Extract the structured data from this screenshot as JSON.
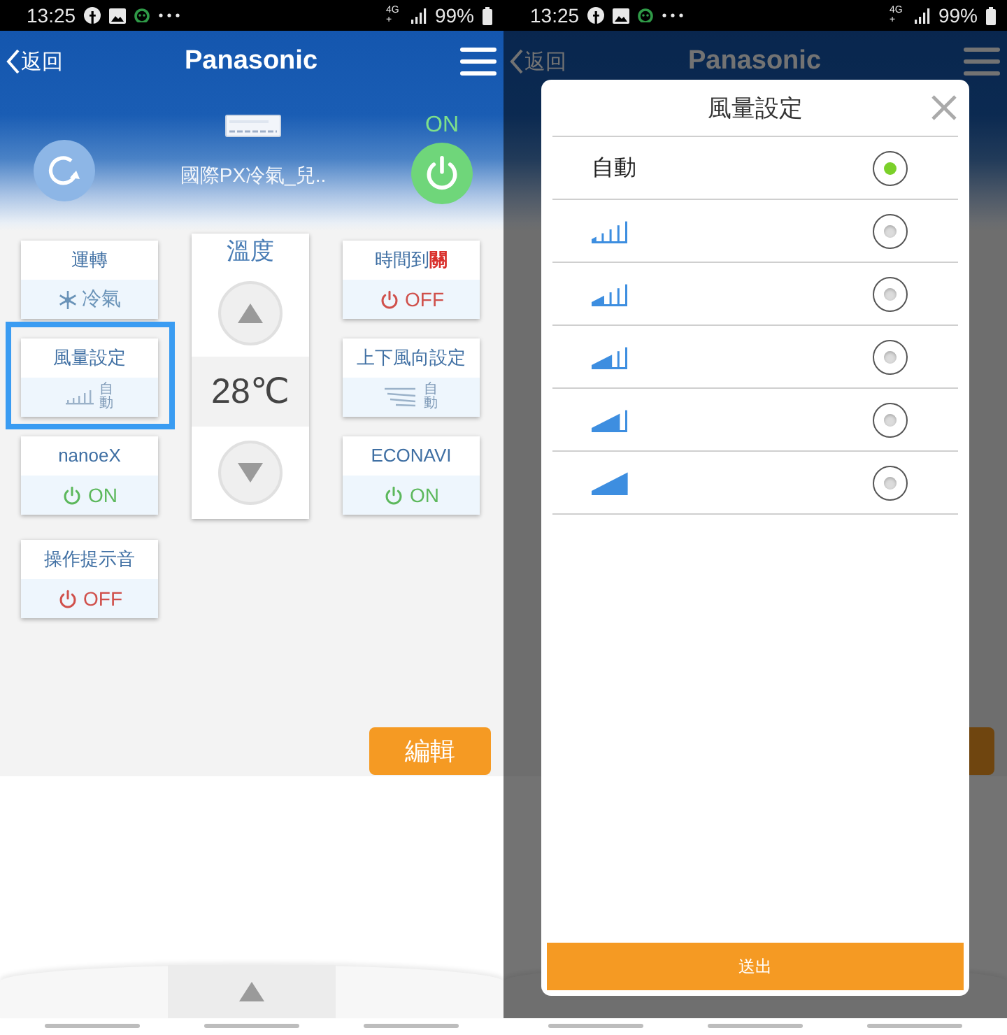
{
  "left_screen": {
    "status_bar": {
      "time": "13:25",
      "network": "4G+",
      "battery": "99%"
    },
    "header": {
      "back": "返回",
      "title": "Panasonic"
    },
    "device": {
      "power_label": "ON",
      "power_on": true,
      "name": "國際PX冷氣_兒.."
    },
    "left_cards": [
      {
        "kind": "mode",
        "title": "運轉",
        "value": "冷氣",
        "selected": false
      },
      {
        "kind": "fan",
        "title": "風量設定",
        "icon_text": "自動",
        "selected": true
      },
      {
        "kind": "power",
        "title": "nanoeX",
        "value": "ON",
        "on": true,
        "selected": false
      },
      {
        "kind": "power",
        "title": "操作提示音",
        "value": "OFF",
        "on": false,
        "selected": false
      }
    ],
    "temperature": {
      "label": "溫度",
      "value": "28℃"
    },
    "right_cards": [
      {
        "kind": "power",
        "title": "時間到",
        "title_suffix": "關",
        "value": "OFF",
        "on": false,
        "selected": false
      },
      {
        "kind": "swing",
        "title": "上下風向設定",
        "icon_text": "自動",
        "selected": false
      },
      {
        "kind": "power",
        "title": "ECONAVI",
        "value": "ON",
        "on": true,
        "selected": false
      }
    ],
    "edit_button": "編輯"
  },
  "right_screen": {
    "status_bar": {
      "time": "13:25",
      "network": "4G+",
      "battery": "99%"
    },
    "header": {
      "back": "返回",
      "title": "Panasonic"
    },
    "dialog": {
      "title": "風量設定",
      "options": [
        {
          "kind": "text",
          "label": "自動",
          "selected": true
        },
        {
          "kind": "speed1",
          "selected": false
        },
        {
          "kind": "speed2",
          "selected": false
        },
        {
          "kind": "speed3",
          "selected": false
        },
        {
          "kind": "speed4",
          "selected": false
        },
        {
          "kind": "speed5",
          "selected": false
        }
      ],
      "submit": "送出"
    }
  }
}
